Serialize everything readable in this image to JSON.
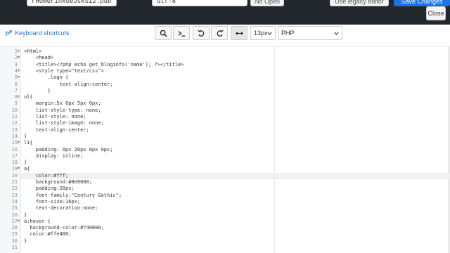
{
  "header": {
    "filename_value": "rHomerinkoeJskSI2.pub",
    "encoding_value": "utf-8",
    "no_open_label": "No Open",
    "legacy_editor_label": "Use legacy editor",
    "save_changes_label": "Save Changes",
    "close_label": "Close"
  },
  "toolbar": {
    "keyboard_shortcuts_label": "Keyboard shortcuts",
    "font_size_value": "13px",
    "mode_value": "PHP"
  },
  "editor": {
    "lines": [
      {
        "n": "1",
        "fold": true,
        "text": "<html>"
      },
      {
        "n": "2",
        "fold": true,
        "text": "    <head>"
      },
      {
        "n": "3",
        "fold": false,
        "text": "    <title><?php echo get_bloginfo('name'); ?></title>"
      },
      {
        "n": "4",
        "fold": true,
        "text": "    <style type=\"text/css\">"
      },
      {
        "n": "5",
        "fold": true,
        "text": "        .logo {"
      },
      {
        "n": "6",
        "fold": false,
        "text": "            text-align:center;"
      },
      {
        "n": "7",
        "fold": false,
        "text": "        }"
      },
      {
        "n": "8",
        "fold": true,
        "text": "ul{"
      },
      {
        "n": "9",
        "fold": false,
        "text": "    margin:5x 0px 5px 0px;"
      },
      {
        "n": "10",
        "fold": false,
        "text": "    list-style-type: none;"
      },
      {
        "n": "11",
        "fold": false,
        "text": "    list-style: none;"
      },
      {
        "n": "12",
        "fold": false,
        "text": "    list-style-image: none;"
      },
      {
        "n": "13",
        "fold": false,
        "text": "    text-align:center;"
      },
      {
        "n": "14",
        "fold": false,
        "text": "}"
      },
      {
        "n": "15",
        "fold": true,
        "text": "li{"
      },
      {
        "n": "16",
        "fold": false,
        "text": "    padding: 0px 20px 0px 0px;"
      },
      {
        "n": "17",
        "fold": false,
        "text": "    display: inline;"
      },
      {
        "n": "18",
        "fold": false,
        "text": "}"
      },
      {
        "n": "19",
        "fold": true,
        "text": "a{"
      },
      {
        "n": "20",
        "fold": false,
        "text": "    color:#fff;"
      },
      {
        "n": "21",
        "fold": false,
        "text": "    background:#8e0000;"
      },
      {
        "n": "22",
        "fold": false,
        "text": "    padding:20px;"
      },
      {
        "n": "23",
        "fold": false,
        "text": "    font-family:\"Century Gothic\";"
      },
      {
        "n": "24",
        "fold": false,
        "text": "    font-size:16px;"
      },
      {
        "n": "25",
        "fold": false,
        "text": "    text-decoration:none;"
      },
      {
        "n": "26",
        "fold": false,
        "text": "}"
      },
      {
        "n": "27",
        "fold": true,
        "text": "a:hover {"
      },
      {
        "n": "28",
        "fold": false,
        "text": "  background-color:#740000;"
      },
      {
        "n": "29",
        "fold": false,
        "text": "  color:#ffe400;"
      },
      {
        "n": "30",
        "fold": false,
        "text": "}"
      },
      {
        "n": "31",
        "fold": false,
        "text": ""
      }
    ],
    "current_line": "20"
  },
  "icons": {
    "search": "search-icon",
    "terminal": "terminal-icon",
    "undo": "undo-icon",
    "redo": "redo-icon",
    "wrap": "wrap-icon",
    "keyboard": "keyboard-icon"
  },
  "colors": {
    "header_bg": "#22272e",
    "accent_blue": "#1a73e8"
  }
}
